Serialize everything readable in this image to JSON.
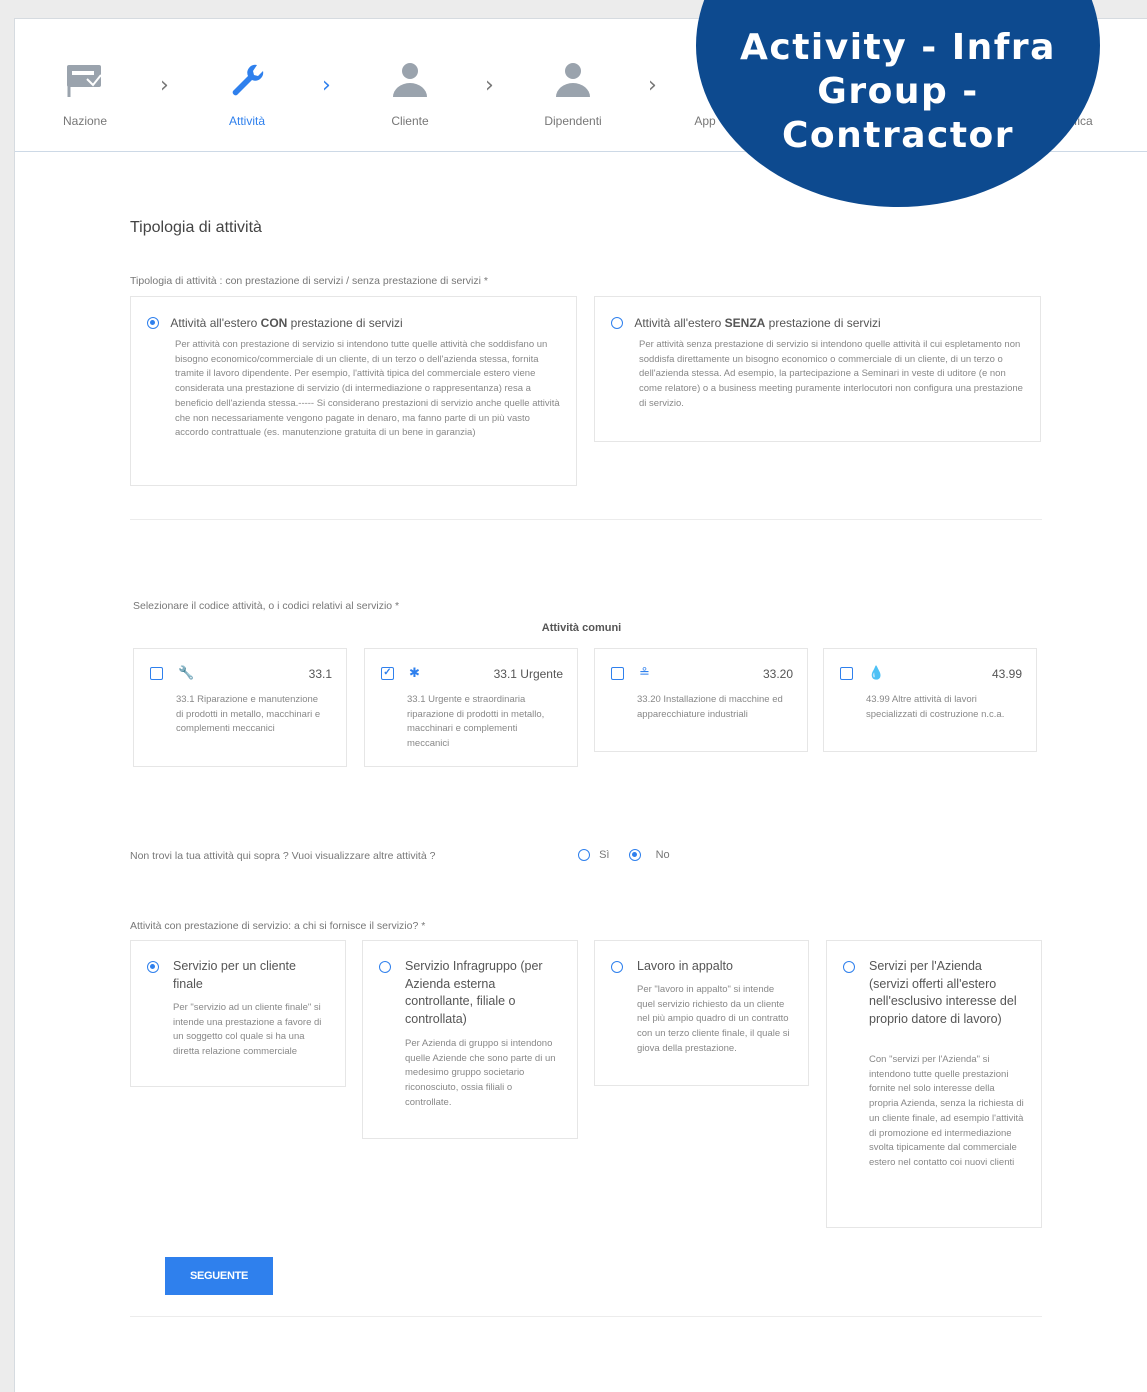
{
  "steps": [
    {
      "label": "Nazione",
      "icon": "flag-icon",
      "active": false
    },
    {
      "label": "Attività",
      "icon": "wrench-icon",
      "active": true
    },
    {
      "label": "Cliente",
      "icon": "person-icon",
      "active": false
    },
    {
      "label": "Dipendenti",
      "icon": "person-icon",
      "active": false
    },
    {
      "label": "App",
      "icon": "document-icon",
      "active": false
    },
    {
      "label": "Verifica",
      "icon": "document-icon",
      "active": false
    }
  ],
  "badge": {
    "lines": [
      "Activity - Infra",
      "Group -",
      "Contractor"
    ]
  },
  "section_title": "Tipologia di attività",
  "q1": {
    "label": "Tipologia di attività : con prestazione di servizi / senza prestazione di servizi *",
    "options": [
      {
        "pre": "Attività all'estero ",
        "bold": "CON",
        "post": " prestazione di servizi",
        "selected": true,
        "desc": "Per attività con prestazione di servizio si intendono tutte quelle attività che soddisfano un bisogno economico/commerciale di un cliente, di un terzo o dell'azienda stessa, fornita tramite il lavoro dipendente. Per esempio, l'attività tipica del commerciale estero viene considerata una prestazione di servizio (di intermediazione o rappresentanza) resa a beneficio dell'azienda stessa.----- Si considerano prestazioni di servizio anche quelle attività che non necessariamente vengono pagate in denaro, ma fanno parte di un più vasto accordo contrattuale (es. manutenzione gratuita di un bene in garanzia)"
      },
      {
        "pre": "Attività all'estero ",
        "bold": "SENZA",
        "post": " prestazione di servizi",
        "selected": false,
        "desc": "Per attività senza prestazione di servizio si intendono quelle attività il cui espletamento non soddisfa direttamente un bisogno economico o commerciale di un cliente, di un terzo o dell'azienda stessa. Ad esempio, la partecipazione a Seminari in veste di uditore (e non come relatore) o a business meeting puramente interlocutori non configura una prestazione di servizio."
      }
    ]
  },
  "q2": {
    "label": "Selezionare il codice attività, o i codici relativi al servizio *",
    "group_title": "Attività comuni",
    "codes": [
      {
        "code": "33.1",
        "icon": "wrench-icon",
        "checked": false,
        "desc": "33.1 Riparazione e manutenzione di prodotti in metallo, macchinari e complementi meccanici"
      },
      {
        "code": "33.1 Urgente",
        "icon": "alert-icon",
        "checked": true,
        "desc": "33.1 Urgente e straordinaria riparazione di prodotti in metallo, macchinari e complementi meccanici"
      },
      {
        "code": "33.20",
        "icon": "install-icon",
        "checked": false,
        "desc": "33.20 Installazione di macchine ed apparecchiature industriali"
      },
      {
        "code": "43.99",
        "icon": "drop-icon",
        "checked": false,
        "desc": "43.99 Altre attività di lavori specializzati di costruzione n.c.a."
      }
    ]
  },
  "q3": {
    "label": "Non trovi la tua attività qui sopra ? Vuoi visualizzare altre attività ?",
    "yes": "Sì",
    "no": "No",
    "selected": "no"
  },
  "q4": {
    "label": "Attività con prestazione di servizio: a chi si fornisce il servizio? *",
    "options": [
      {
        "title": "Servizio per un cliente finale",
        "selected": true,
        "desc": "Per \"servizio ad un cliente finale\" si intende una prestazione a favore di un soggetto col quale si ha una diretta relazione commerciale"
      },
      {
        "title": "Servizio Infragruppo (per Azienda esterna controllante, filiale o controllata)",
        "selected": false,
        "desc": "Per Azienda di gruppo si intendono quelle Aziende che sono parte di un medesimo gruppo societario riconosciuto, ossia filiali o controllate."
      },
      {
        "title": "Lavoro in appalto",
        "selected": false,
        "desc": "Per \"lavoro in appalto\" si intende quel servizio richiesto da un cliente nel più ampio quadro di un contratto con un terzo cliente finale, il quale si giova della prestazione."
      },
      {
        "title": "Servizi per l'Azienda (servizi offerti all'estero nell'esclusivo interesse del proprio datore di lavoro)",
        "selected": false,
        "desc": "Con \"servizi per l'Azienda\" si intendono tutte quelle prestazioni fornite nel solo interesse della propria Azienda, senza la richiesta di un cliente finale, ad esempio l'attività di promozione ed intermediazione svolta tipicamente dal commerciale estero nel contatto coi nuovi clienti"
      }
    ]
  },
  "next_button": "SEGUENTE",
  "colors": {
    "accent": "#2f80ed",
    "badge": "#0d4a8f"
  }
}
